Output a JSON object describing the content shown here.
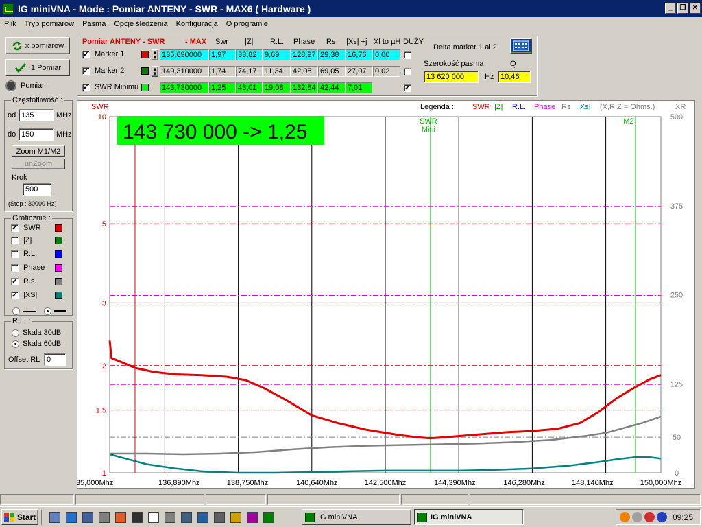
{
  "window": {
    "title": "IG miniVNA - Mode : Pomiar ANTENY - SWR    - MAX6 ( Hardware )"
  },
  "menu": [
    "Plik",
    "Tryb pomiarów",
    "Pasma",
    "Opcje śledzenia",
    "Konfiguracja",
    "O programie"
  ],
  "left": {
    "x_pomiarow": "x pomiarów",
    "one_pomiar": "1 Pomiar",
    "pomiar": "Pomiar",
    "freq_group": "Częstotliwość :",
    "od_label": "od",
    "od_value": "135",
    "od_unit": "MHz",
    "do_label": "do",
    "do_value": "150",
    "do_unit": "MHz",
    "zoom": "Zoom M1/M2",
    "unzoom": "unZoom",
    "krok_label": "Krok",
    "krok_value": "500",
    "step_text": "(Step : 30000 Hz)",
    "graf_group": "Graficznie :",
    "graf_items": [
      {
        "label": "SWR",
        "checked": "✓",
        "color": "#e00000"
      },
      {
        "label": "|Z|",
        "checked": "",
        "color": "#008000"
      },
      {
        "label": "R.L.",
        "checked": "",
        "color": "#0000ff"
      },
      {
        "label": "Phase",
        "checked": "",
        "color": "#ff00ff"
      },
      {
        "label": "R.s.",
        "checked": "✓",
        "color": "#808080"
      },
      {
        "label": "|XS|",
        "checked": "✓",
        "color": "#008080"
      }
    ],
    "rl_group": "R.L. :",
    "skala30": "Skala 30dB",
    "skala60": "Skala 60dB",
    "offset_label": "Offset RL",
    "offset_value": "0"
  },
  "table": {
    "title_red": "Pomiar ANTENY - SWR",
    "title_max": "- MAX",
    "headers": [
      "Swr",
      "|Z|",
      "R.L.",
      "Phase",
      "Rs",
      "|Xs| +j",
      "Xl to µH",
      "DUŻY"
    ],
    "rows": [
      {
        "label": "Marker 1",
        "swatch": "#e00000",
        "freq": "135,690000",
        "vals": [
          "1,97",
          "33,82",
          "9,69",
          "128,97",
          "29,38",
          "16,76",
          "0,00"
        ],
        "bg": "#00ffff"
      },
      {
        "label": "Marker 2",
        "swatch": "#008000",
        "freq": "149,310000",
        "vals": [
          "1,74",
          "74,17",
          "11,34",
          "42,05",
          "69,05",
          "27,07",
          "0,02"
        ],
        "bg": "#d4d0c8"
      },
      {
        "label": "SWR Minimu",
        "swatch": "#00ff00",
        "freq": "143,730000",
        "vals": [
          "1,25",
          "43,01",
          "19,08",
          "132,84",
          "42,44",
          "7,01"
        ],
        "bg": "#00ff00"
      }
    ],
    "delta_label": "Delta marker 1 al 2",
    "bw_label": "Szerokość pasma",
    "bw_value": "13 620 000",
    "hz": "Hz",
    "q_label": "Q",
    "q_value": "10,46"
  },
  "chart": {
    "left_axis_title": "SWR",
    "right_axis_title": "XR",
    "legend_title": "Legenda :",
    "legend_items": [
      {
        "text": "SWR",
        "color": "#e00000"
      },
      {
        "text": "|Z|",
        "color": "#008000"
      },
      {
        "text": "R.L.",
        "color": "#0000ff"
      },
      {
        "text": "Phase",
        "color": "#ff00ff"
      },
      {
        "text": "Rs",
        "color": "#808080"
      },
      {
        "text": "|Xs|",
        "color": "#008080"
      },
      {
        "text": "(X,R,Z = Ohms.)",
        "color": "#808080"
      }
    ],
    "banner": "143 730 000 -> 1,25",
    "marker_swr_label1": "SWR",
    "marker_swr_label2": "Mini",
    "marker_m2_label": "M2"
  },
  "chart_data": {
    "type": "line",
    "xlabel": "",
    "ylabel": "SWR",
    "xlim": [
      135.0,
      150.0
    ],
    "x_ticks": [
      "135,000Mhz",
      "136,890Mhz",
      "138,750Mhz",
      "140,640Mhz",
      "142,500Mhz",
      "144,390Mhz",
      "146,280Mhz",
      "148,140Mhz",
      "150,000Mhz"
    ],
    "y_left_ticks": [
      "10",
      "5",
      "3",
      "2",
      "1.5",
      "1"
    ],
    "y_right_ticks": [
      "500",
      "375",
      "250",
      "125",
      "50",
      "0"
    ],
    "series": [
      {
        "name": "SWR",
        "color": "#e00000",
        "x": [
          135.0,
          135.05,
          135.3,
          135.7,
          136.2,
          136.8,
          137.5,
          138.2,
          138.7,
          139.2,
          139.8,
          140.5,
          141.2,
          142.0,
          142.8,
          143.3,
          143.73,
          144.2,
          145.0,
          145.8,
          146.5,
          147.2,
          147.8,
          148.3,
          148.8,
          149.3,
          149.7,
          150.0
        ],
        "y": [
          2.35,
          2.1,
          2.05,
          1.97,
          1.92,
          1.89,
          1.88,
          1.86,
          1.82,
          1.73,
          1.6,
          1.45,
          1.38,
          1.32,
          1.28,
          1.26,
          1.25,
          1.26,
          1.28,
          1.3,
          1.31,
          1.33,
          1.38,
          1.48,
          1.62,
          1.74,
          1.83,
          1.88
        ]
      },
      {
        "name": "Rs",
        "color": "#808080",
        "right_axis": true,
        "x": [
          135.0,
          136.0,
          137.0,
          138.0,
          139.0,
          140.0,
          141.0,
          142.0,
          143.0,
          144.0,
          145.0,
          146.0,
          147.0,
          148.0,
          148.5,
          149.0,
          149.5,
          150.0
        ],
        "y": [
          27,
          27,
          26,
          27,
          29,
          33,
          36,
          38,
          39,
          40,
          41,
          43,
          46,
          52,
          56,
          63,
          70,
          79
        ]
      },
      {
        "name": "|Xs|",
        "color": "#008080",
        "right_axis": true,
        "x": [
          135.0,
          135.5,
          136.0,
          136.8,
          137.5,
          138.5,
          139.5,
          140.5,
          141.5,
          142.5,
          143.5,
          144.5,
          145.5,
          146.5,
          147.5,
          148.3,
          148.8,
          149.3,
          149.7,
          150.0
        ],
        "y": [
          26,
          19,
          12,
          6,
          2,
          0,
          0,
          1,
          2,
          3,
          3,
          3,
          4,
          6,
          10,
          15,
          19,
          22,
          22,
          20
        ]
      }
    ],
    "markers": [
      {
        "name": "Marker 1",
        "x": 135.69,
        "color": "#e00000"
      },
      {
        "name": "SWR Mini",
        "x": 143.73,
        "color": "#00c000"
      },
      {
        "name": "M2",
        "x": 149.31,
        "color": "#00c000"
      }
    ]
  },
  "taskbar": {
    "start": "Start",
    "task1": "IG miniVNA",
    "task2": "IG miniVNA",
    "clock": "09:25"
  }
}
